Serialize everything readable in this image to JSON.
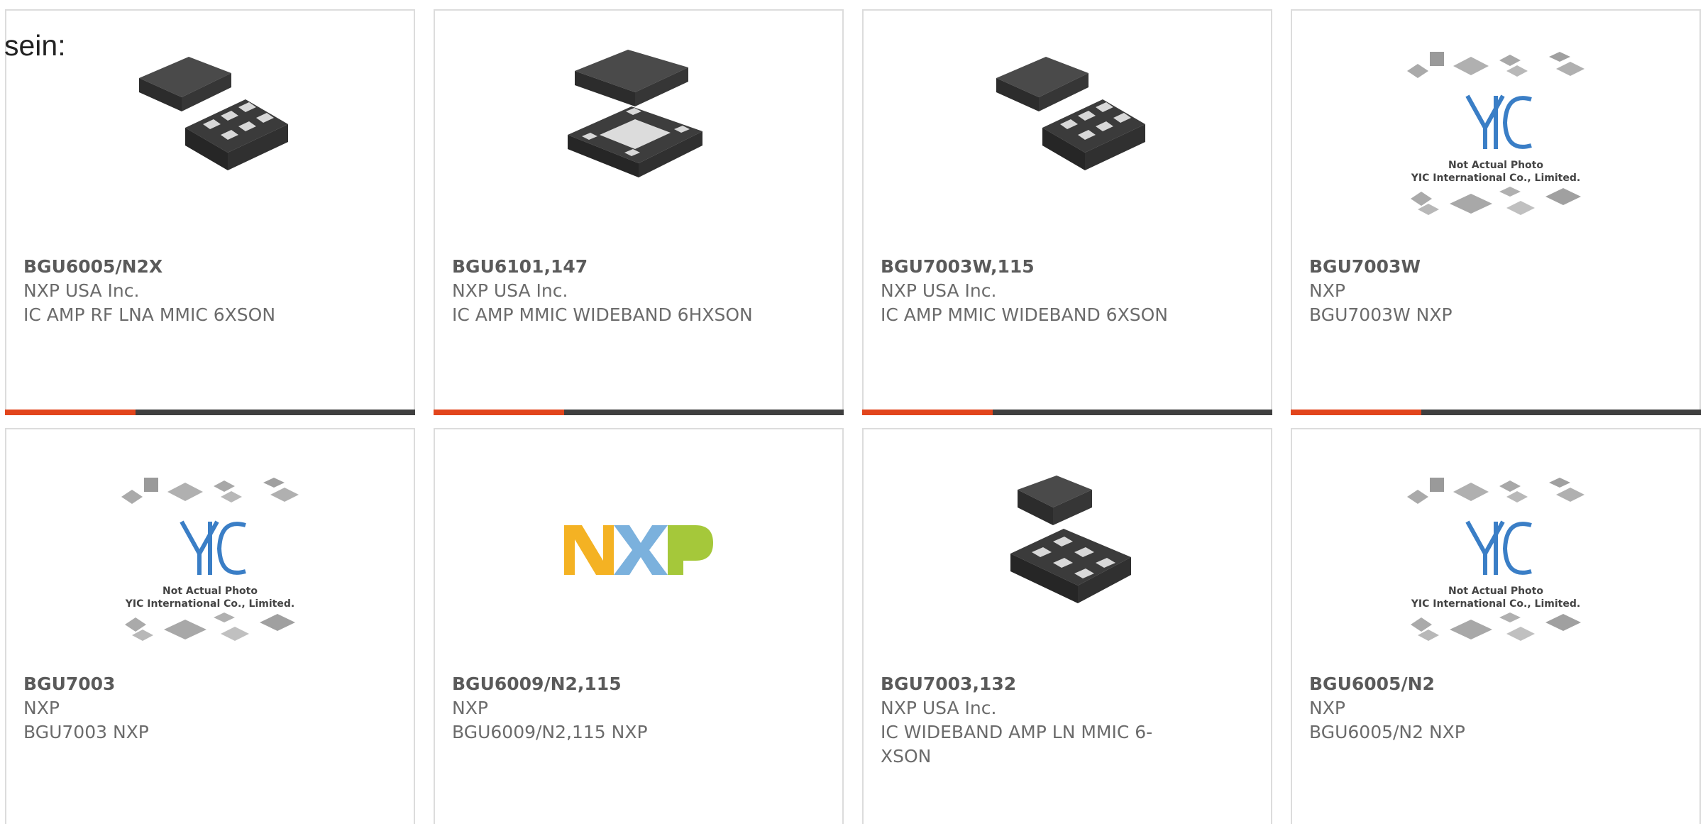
{
  "intro_text": "sein:",
  "colors": {
    "accent": "#e2451c",
    "bar": "#3f3f3f",
    "text": "#6b6b6b",
    "border": "#dcdcdc"
  },
  "products": [
    {
      "part": "BGU6005/N2X",
      "manufacturer": "NXP USA Inc.",
      "description": "IC AMP RF LNA MMIC 6XSON",
      "image": "dfn-6-pad-package"
    },
    {
      "part": "BGU6101,147",
      "manufacturer": "NXP USA Inc.",
      "description": "IC AMP MMIC WIDEBAND 6HXSON",
      "image": "dfn-exposed-pad-package"
    },
    {
      "part": "BGU7003W,115",
      "manufacturer": "NXP USA Inc.",
      "description": "IC AMP MMIC WIDEBAND 6XSON",
      "image": "dfn-6-pad-package"
    },
    {
      "part": "BGU7003W",
      "manufacturer": "NXP",
      "description": "BGU7003W NXP",
      "image": "yic-placeholder"
    },
    {
      "part": "BGU7003",
      "manufacturer": "NXP",
      "description": "BGU7003 NXP",
      "image": "yic-placeholder"
    },
    {
      "part": "BGU6009/N2,115",
      "manufacturer": "NXP",
      "description": "BGU6009/N2,115 NXP",
      "image": "nxp-logo"
    },
    {
      "part": "BGU7003,132",
      "manufacturer": "NXP USA Inc.",
      "description": "IC WIDEBAND AMP LN MMIC 6-XSON",
      "image": "dfn-6-pad-package"
    },
    {
      "part": "BGU6005/N2",
      "manufacturer": "NXP",
      "description": "BGU6005/N2 NXP",
      "image": "yic-placeholder"
    }
  ],
  "placeholder": {
    "line1": "Not Actual Photo",
    "line2": "YIC International Co., Limited."
  }
}
